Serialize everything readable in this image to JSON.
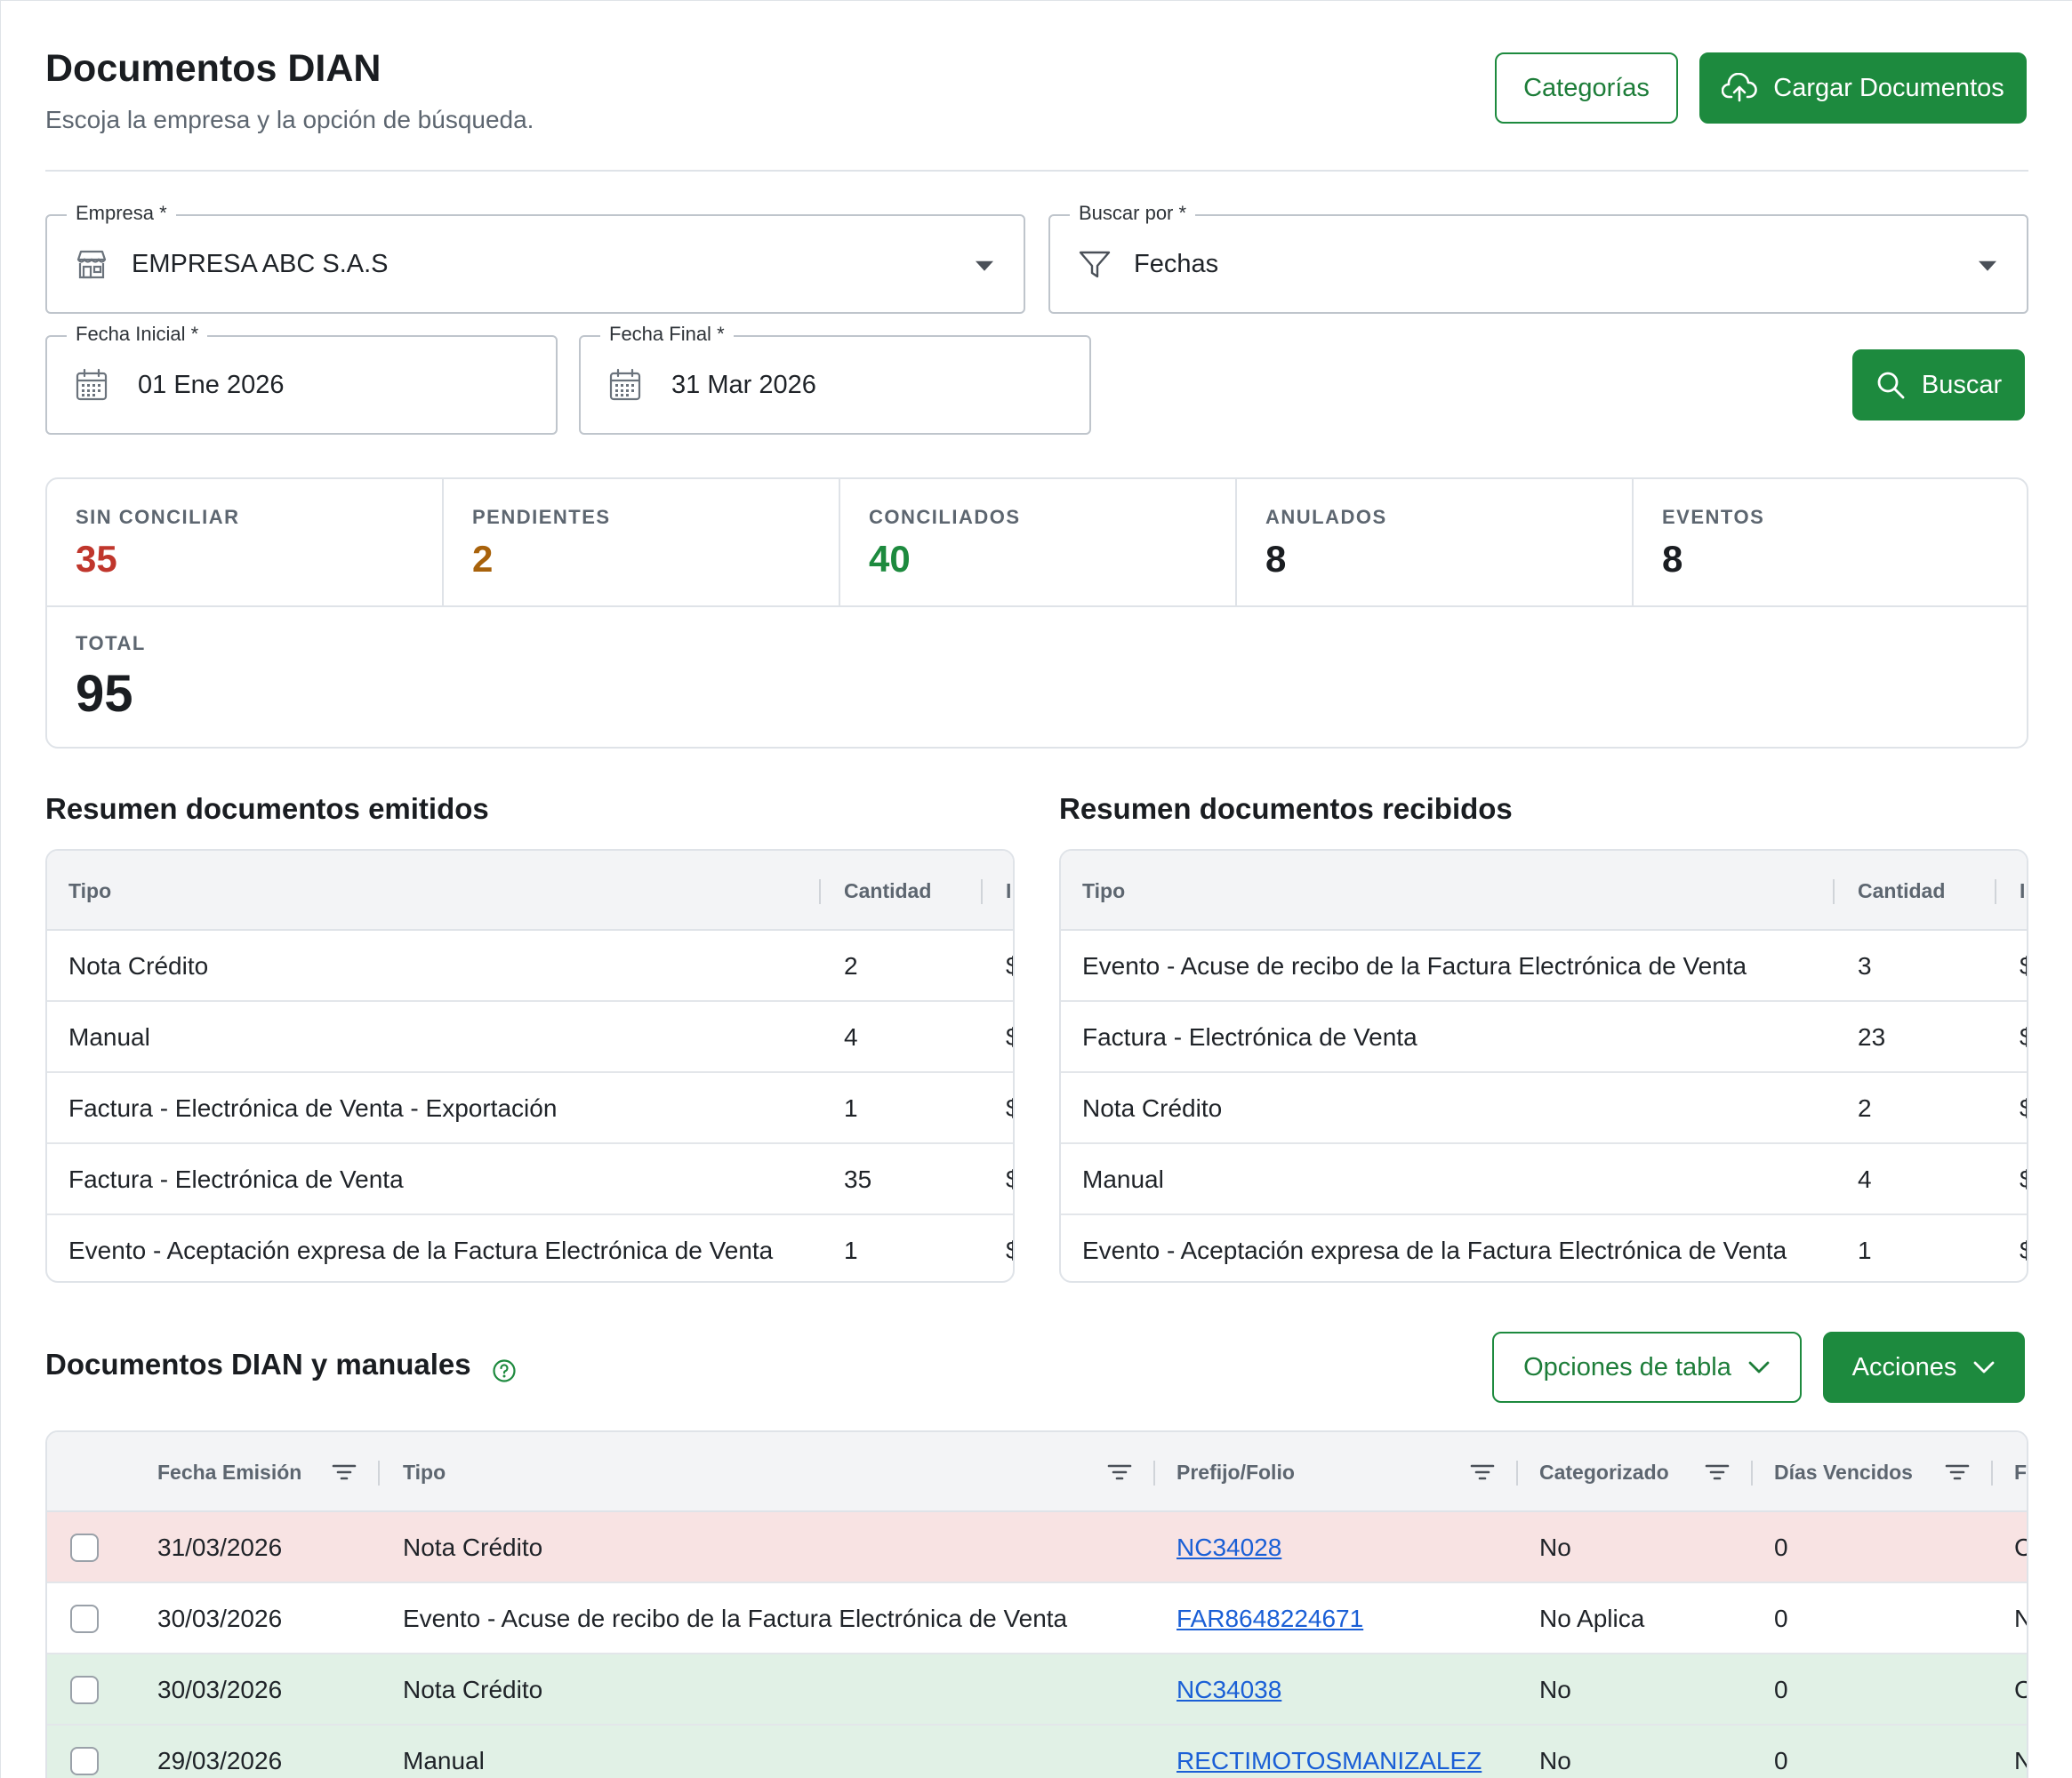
{
  "header": {
    "title": "Documentos DIAN",
    "subtitle": "Escoja la empresa y la opción de búsqueda.",
    "categories_label": "Categorías",
    "upload_label": "Cargar Documentos"
  },
  "filters": {
    "company": {
      "label": "Empresa",
      "required": "*",
      "value": "EMPRESA ABC S.A.S"
    },
    "search_by": {
      "label": "Buscar por",
      "required": "*",
      "value": "Fechas"
    },
    "start_date": {
      "label": "Fecha Inicial",
      "required": "*",
      "value": "01 Ene 2026"
    },
    "end_date": {
      "label": "Fecha Final",
      "required": "*",
      "value": "31 Mar 2026"
    },
    "search_label": "Buscar"
  },
  "stats": {
    "items": [
      {
        "label": "SIN CONCILIAR",
        "value": "35",
        "color": "#c0362c"
      },
      {
        "label": "PENDIENTES",
        "value": "2",
        "color": "#a8620b"
      },
      {
        "label": "CONCILIADOS",
        "value": "40",
        "color": "#1d8a3e"
      },
      {
        "label": "ANULADOS",
        "value": "8",
        "color": "#1a1d21"
      },
      {
        "label": "EVENTOS",
        "value": "8",
        "color": "#1a1d21"
      }
    ],
    "total": {
      "label": "TOTAL",
      "value": "95"
    }
  },
  "issued_summary": {
    "title": "Resumen documentos emitidos",
    "columns": [
      "Tipo",
      "Cantidad",
      "I"
    ],
    "rows": [
      {
        "type": "Nota Crédito",
        "qty": "2",
        "extra": "$"
      },
      {
        "type": "Manual",
        "qty": "4",
        "extra": "$"
      },
      {
        "type": "Factura - Electrónica de Venta - Exportación",
        "qty": "1",
        "extra": "$"
      },
      {
        "type": "Factura - Electrónica de Venta",
        "qty": "35",
        "extra": "$"
      },
      {
        "type": "Evento - Aceptación expresa de la Factura Electrónica de Venta",
        "qty": "1",
        "extra": "$"
      }
    ]
  },
  "received_summary": {
    "title": "Resumen documentos recibidos",
    "columns": [
      "Tipo",
      "Cantidad",
      "I"
    ],
    "rows": [
      {
        "type": "Evento - Acuse de recibo de la Factura Electrónica de Venta",
        "qty": "3",
        "extra": "$"
      },
      {
        "type": "Factura - Electrónica de Venta",
        "qty": "23",
        "extra": "$"
      },
      {
        "type": "Nota Crédito",
        "qty": "2",
        "extra": "$"
      },
      {
        "type": "Manual",
        "qty": "4",
        "extra": "$"
      },
      {
        "type": "Evento - Aceptación expresa de la Factura Electrónica de Venta",
        "qty": "1",
        "extra": "$"
      }
    ]
  },
  "documents": {
    "title": "Documentos DIAN y manuales",
    "table_options_label": "Opciones de tabla",
    "actions_label": "Acciones",
    "columns": [
      "Fecha Emisión",
      "Tipo",
      "Prefijo/Folio",
      "Categorizado",
      "Días Vencidos",
      "F"
    ],
    "rows": [
      {
        "date": "31/03/2026",
        "type": "Nota Crédito",
        "folio": "NC34028",
        "categorized": "No",
        "days": "0",
        "extra": "C",
        "bg": "#f8e3e3"
      },
      {
        "date": "30/03/2026",
        "type": "Evento - Acuse de recibo de la Factura Electrónica de Venta",
        "folio": "FAR8648224671",
        "categorized": "No Aplica",
        "days": "0",
        "extra": "N",
        "bg": "#ffffff"
      },
      {
        "date": "30/03/2026",
        "type": "Nota Crédito",
        "folio": "NC34038",
        "categorized": "No",
        "days": "0",
        "extra": "C",
        "bg": "#e1f1e6"
      },
      {
        "date": "29/03/2026",
        "type": "Manual",
        "folio": "RECTIMOTOSMANIZALEZ",
        "categorized": "No",
        "days": "0",
        "extra": "N",
        "bg": "#e1f1e6"
      }
    ]
  }
}
